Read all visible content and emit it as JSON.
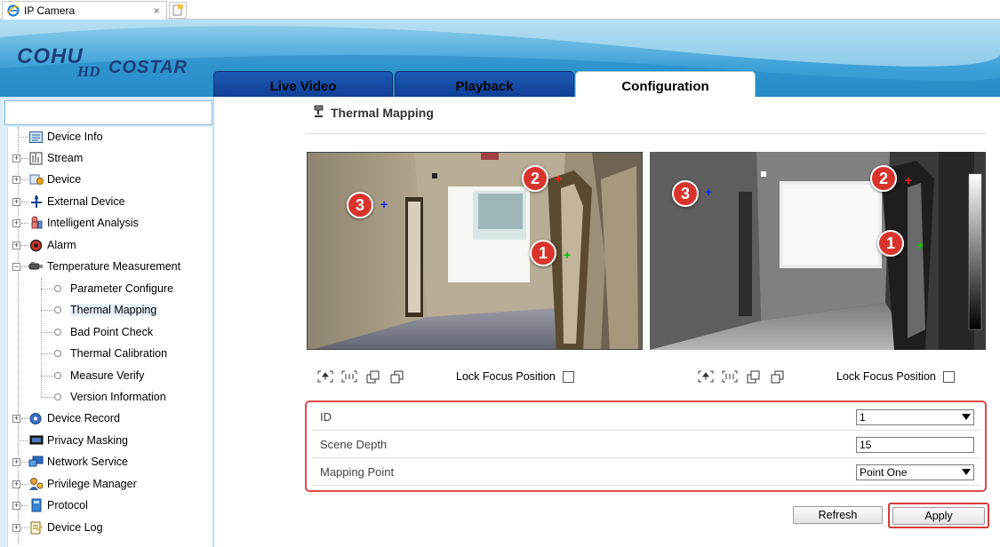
{
  "browser": {
    "tab_title": "IP Camera",
    "close_glyph": "×"
  },
  "header": {
    "logo_cohu": "COHU",
    "logo_hd": "HD",
    "logo_costar": "COSTAR",
    "tabs": [
      {
        "label": "Live Video",
        "active": false
      },
      {
        "label": "Playback",
        "active": false
      },
      {
        "label": "Configuration",
        "active": true
      }
    ]
  },
  "sidebar": {
    "search_value": "",
    "items": [
      {
        "label": "Device Info",
        "icon": "device-info-icon",
        "expandable": false
      },
      {
        "label": "Stream",
        "icon": "stream-icon",
        "expandable": true
      },
      {
        "label": "Device",
        "icon": "device-icon",
        "expandable": true
      },
      {
        "label": "External Device",
        "icon": "external-device-icon",
        "expandable": true
      },
      {
        "label": "Intelligent Analysis",
        "icon": "intelligent-analysis-icon",
        "expandable": true
      },
      {
        "label": "Alarm",
        "icon": "alarm-icon",
        "expandable": true
      },
      {
        "label": "Temperature Measurement",
        "icon": "temperature-icon",
        "expandable": true,
        "expanded": true
      },
      {
        "label": "Device Record",
        "icon": "device-record-icon",
        "expandable": true
      },
      {
        "label": "Privacy Masking",
        "icon": "privacy-masking-icon",
        "expandable": false
      },
      {
        "label": "Network Service",
        "icon": "network-service-icon",
        "expandable": true
      },
      {
        "label": "Privilege Manager",
        "icon": "privilege-manager-icon",
        "expandable": true
      },
      {
        "label": "Protocol",
        "icon": "protocol-icon",
        "expandable": true
      },
      {
        "label": "Device Log",
        "icon": "device-log-icon",
        "expandable": true
      }
    ],
    "sub_items": [
      {
        "label": "Parameter Configure"
      },
      {
        "label": "Thermal Mapping",
        "selected": true
      },
      {
        "label": "Bad Point Check"
      },
      {
        "label": "Thermal Calibration"
      },
      {
        "label": "Measure Verify"
      },
      {
        "label": "Version Information"
      }
    ]
  },
  "page": {
    "title": "Thermal Mapping",
    "markers": {
      "one": "1",
      "two": "2",
      "three": "3"
    },
    "lock_focus_label": "Lock Focus Position",
    "form": {
      "id_label": "ID",
      "id_value": "1",
      "scene_depth_label": "Scene Depth",
      "scene_depth_value": "15",
      "mapping_point_label": "Mapping Point",
      "mapping_point_value": "Point One"
    },
    "refresh_label": "Refresh",
    "apply_label": "Apply"
  },
  "colors": {
    "header_blue": "#2c93cc",
    "tab_inactive": "#0f3f95",
    "marker_red": "#d9342b",
    "highlight_red": "#e04848",
    "crosshair_green": "#00c000",
    "crosshair_red": "#ff2020",
    "crosshair_blue": "#1a2fe0"
  }
}
